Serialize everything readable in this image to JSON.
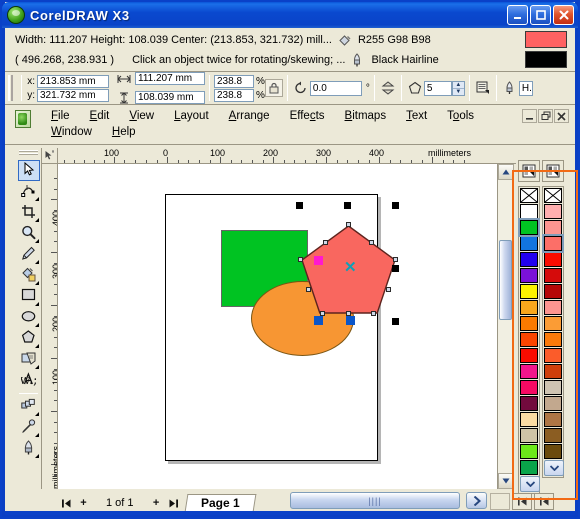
{
  "window": {
    "title": "CorelDRAW X3",
    "icon": "corel-balloon-icon",
    "minimize_label": "_",
    "maximize_label": "□",
    "close_label": "✕"
  },
  "status_info": {
    "dimensions_line": "Width: 111.207  Height: 108.039  Center: (213.853, 321.732)  mill...",
    "coordinates": "( 496.268, 238.931 )",
    "hint": "Click an object twice for rotating/skewing; ...",
    "fill_color_label": "R255 G98 B98",
    "outline_label": "Black  Hairline",
    "fill_swatch_color": "#ff6262",
    "outline_swatch_color": "#000000",
    "fill_icon": "paint-bucket-icon",
    "outline_icon": "pen-nib-icon"
  },
  "property_bar": {
    "x_label": "x:",
    "y_label": "y:",
    "x_value": "213.853 mm",
    "y_value": "321.732 mm",
    "width_value": "111.207 mm",
    "height_value": "108.039 mm",
    "scale_h_value": "238.8",
    "scale_v_value": "238.8",
    "percent_symbol": "%",
    "lock_ratio_icon": "lock-ratio-icon",
    "rotation_value": "0.0",
    "rotation_unit": "°",
    "rotation_icon": "rotate-icon",
    "mirror_icon": "mirror-vertical-icon",
    "polygon_icon": "polygon-icon",
    "sides_value": "5",
    "order_icon": "to-front-icon",
    "outline_width_icon": "outline-pen-icon",
    "outline_width_value": "H...",
    "width_icon": "horizontal-size-icon",
    "height_icon": "vertical-size-icon"
  },
  "menu": {
    "row1": [
      {
        "label": "File",
        "accel": "F"
      },
      {
        "label": "Edit",
        "accel": "E"
      },
      {
        "label": "View",
        "accel": "V"
      },
      {
        "label": "Layout",
        "accel": "L"
      },
      {
        "label": "Arrange",
        "accel": "A"
      },
      {
        "label": "Effects",
        "accel": "c"
      },
      {
        "label": "Bitmaps",
        "accel": "B"
      },
      {
        "label": "Text",
        "accel": "T"
      },
      {
        "label": "Tools",
        "accel": "o"
      }
    ],
    "row2": [
      {
        "label": "Window",
        "accel": "W"
      },
      {
        "label": "Help",
        "accel": "H"
      }
    ],
    "doc_minimize": "_",
    "doc_restore": "❐",
    "doc_close": "✕",
    "doc_icon": "document-icon"
  },
  "rulers": {
    "h_unit": "millimeters",
    "h_ticks": [
      "100",
      "0",
      "100",
      "200",
      "300",
      "400"
    ],
    "v_ticks": [
      "400",
      "300",
      "200",
      "100"
    ],
    "v_unit": "millimeters",
    "corner_icon": "ruler-origin-icon"
  },
  "toolbox": [
    {
      "name": "pick-tool",
      "icon": "arrow-cursor-icon",
      "selected": true,
      "flyout": false
    },
    {
      "name": "shape-tool",
      "icon": "node-edit-icon",
      "selected": false,
      "flyout": true
    },
    {
      "name": "crop-tool",
      "icon": "crop-icon",
      "selected": false,
      "flyout": true
    },
    {
      "name": "zoom-tool",
      "icon": "magnifier-icon",
      "selected": false,
      "flyout": true
    },
    {
      "name": "freehand-tool",
      "icon": "pencil-icon",
      "selected": false,
      "flyout": true
    },
    {
      "name": "smart-fill-tool",
      "icon": "smart-fill-icon",
      "selected": false,
      "flyout": true
    },
    {
      "name": "rectangle-tool",
      "icon": "rectangle-icon",
      "selected": false,
      "flyout": true
    },
    {
      "name": "ellipse-tool",
      "icon": "ellipse-icon",
      "selected": false,
      "flyout": true
    },
    {
      "name": "polygon-tool",
      "icon": "polygon-icon",
      "selected": false,
      "flyout": true
    },
    {
      "name": "basic-shapes-tool",
      "icon": "basic-shapes-icon",
      "selected": false,
      "flyout": true
    },
    {
      "name": "text-tool",
      "icon": "text-a-icon",
      "selected": false,
      "flyout": false
    },
    {
      "name": "interactive-blend-tool",
      "icon": "blend-icon",
      "selected": false,
      "flyout": true
    },
    {
      "name": "eyedropper-tool",
      "icon": "eyedropper-icon",
      "selected": false,
      "flyout": true
    },
    {
      "name": "outline-tool",
      "icon": "pen-nib-icon",
      "selected": false,
      "flyout": true
    }
  ],
  "canvas": {
    "shapes": [
      {
        "name": "green-rectangle",
        "type": "rect",
        "fill": "#00c322",
        "outline": "#666666"
      },
      {
        "name": "orange-ellipse",
        "type": "ellipse",
        "fill": "#f79633",
        "outline": "#7a5513"
      },
      {
        "name": "red-pentagon",
        "type": "polygon",
        "sides": 5,
        "fill": "#f9675f",
        "outline": "#6b2b24",
        "selected": true
      }
    ],
    "center_marker": "✕",
    "center_marker_color": "#0fa0b7",
    "selection_handle_color": "#000000",
    "pink_anchor_color": "#ff19cf",
    "blue_anchor_color": "#0b56c9"
  },
  "palette": {
    "column1_header_icon": "palette-options-icon",
    "column2_header_icon": "palette-options-icon",
    "column1": [
      {
        "name": "no-fill",
        "color": "none",
        "selected": false
      },
      {
        "name": "white",
        "color": "#ffffff",
        "selected": false
      },
      {
        "name": "green",
        "color": "#00c322",
        "selected": true
      },
      {
        "name": "azure-blue",
        "color": "#1275e0",
        "selected": false
      },
      {
        "name": "blue",
        "color": "#2200ee",
        "selected": false
      },
      {
        "name": "violet",
        "color": "#7b11d8",
        "selected": false
      },
      {
        "name": "yellow",
        "color": "#fdf200",
        "selected": false
      },
      {
        "name": "light-orange",
        "color": "#f9a61c",
        "selected": false
      },
      {
        "name": "orange",
        "color": "#fb7a00",
        "selected": false
      },
      {
        "name": "red-orange",
        "color": "#fb4500",
        "selected": false
      },
      {
        "name": "red",
        "color": "#f90c00",
        "selected": false
      },
      {
        "name": "magenta",
        "color": "#f2158c",
        "selected": false
      },
      {
        "name": "pink-red",
        "color": "#f60a63",
        "selected": false
      },
      {
        "name": "dark-purple",
        "color": "#720a3d",
        "selected": false
      },
      {
        "name": "peach",
        "color": "#fbdca4",
        "selected": false
      },
      {
        "name": "tan",
        "color": "#cfc4a6",
        "selected": false
      },
      {
        "name": "bright-green",
        "color": "#6ce81a",
        "selected": false
      },
      {
        "name": "emerald-green",
        "color": "#0aa54a",
        "selected": false
      }
    ],
    "column2": [
      {
        "name": "no-fill",
        "color": "none",
        "selected": false
      },
      {
        "name": "light-pink",
        "color": "#ffafaf",
        "selected": false
      },
      {
        "name": "salmon-pink",
        "color": "#fc9590",
        "selected": false
      },
      {
        "name": "salmon-selected",
        "color": "#fc6f68",
        "selected": true
      },
      {
        "name": "bright-red",
        "color": "#f90c00",
        "selected": false
      },
      {
        "name": "crimson",
        "color": "#d50b0b",
        "selected": false
      },
      {
        "name": "dark-red",
        "color": "#b50707",
        "selected": false
      },
      {
        "name": "light-salmon",
        "color": "#fc9590",
        "selected": false
      },
      {
        "name": "light-orange",
        "color": "#fb9c35",
        "selected": false
      },
      {
        "name": "orange",
        "color": "#fb7a0a",
        "selected": false
      },
      {
        "name": "coral",
        "color": "#fb5c2a",
        "selected": false
      },
      {
        "name": "burnt-orange",
        "color": "#cf3f0b",
        "selected": false
      },
      {
        "name": "beige",
        "color": "#cfc4b2",
        "selected": false
      },
      {
        "name": "taupe",
        "color": "#c2a88e",
        "selected": false
      },
      {
        "name": "light-brown",
        "color": "#ae7545",
        "selected": false
      },
      {
        "name": "brown",
        "color": "#8b5d22",
        "selected": false
      },
      {
        "name": "dark-brown",
        "color": "#6b4a0c",
        "selected": false
      }
    ],
    "scroll_down_label": "⌄"
  },
  "scrollbars": {
    "v_up_label": "▲",
    "v_down_label": "▼",
    "h_right_label": "❯",
    "h_left_label": "❮",
    "grip_label": "||||"
  },
  "page_nav": {
    "first_label": "◀|",
    "add_before_label": "+",
    "count_label": "1 of 1",
    "add_after_label": "+",
    "last_label": "|▶",
    "tab_label": "Page 1"
  },
  "bottom_right": {
    "btn1_icon": "first-page-icon",
    "btn1_label": "|◀",
    "btn2_icon": "last-page-icon",
    "btn2_label": "|◀"
  },
  "colors": {
    "titlebar_blue": "#0a43c8",
    "face": "#ece9d8",
    "border": "#9b9684",
    "annotation_orange": "#f26a14"
  }
}
